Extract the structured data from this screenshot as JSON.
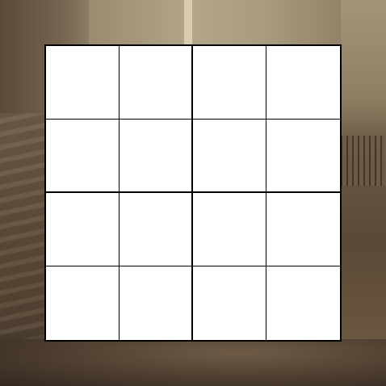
{
  "puzzle": {
    "rows": 4,
    "cols": 4,
    "box_rows": 2,
    "box_cols": 2,
    "cells": [
      [
        "",
        "",
        "",
        ""
      ],
      [
        "",
        "",
        "",
        ""
      ],
      [
        "",
        "",
        "",
        ""
      ],
      [
        "",
        "",
        "",
        ""
      ]
    ]
  },
  "colors": {
    "grid_line": "#000000",
    "cell_background": "#ffffff"
  }
}
